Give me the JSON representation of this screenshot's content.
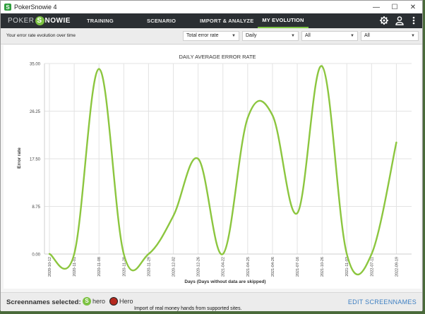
{
  "window": {
    "title": "PokerSnowie 4",
    "controls": [
      "—",
      "☐",
      "✕"
    ]
  },
  "logo": {
    "part1": "POKER",
    "s": "S",
    "part2": "NOWIE"
  },
  "nav": {
    "items": [
      {
        "label": "TRAINING",
        "active": false
      },
      {
        "label": "SCENARIO",
        "active": false
      },
      {
        "label": "IMPORT & ANALYZE",
        "active": false
      },
      {
        "label": "MY EVOLUTION",
        "active": true
      }
    ],
    "icons": [
      "gear-icon",
      "user-icon",
      "more-vertical-icon"
    ]
  },
  "filters": {
    "label": "Your error rate evolution over time",
    "metric": "Total error rate",
    "period": "Daily",
    "filter1": "All",
    "filter2": "All"
  },
  "chart_data": {
    "type": "line",
    "title": "DAILY AVERAGE ERROR RATE",
    "xlabel": "Days (Days without data are skipped)",
    "ylabel": "Error rate",
    "ylim": [
      0,
      35
    ],
    "yticks": [
      "0.00",
      "8.75",
      "17.50",
      "26.25",
      "35.00"
    ],
    "categories": [
      "2020-10-12",
      "2020-11-01",
      "2020-11-08",
      "2020-11-28",
      "2020-11-29",
      "2020-12-02",
      "2020-12-26",
      "2021-04-22",
      "2021-04-25",
      "2021-04-26",
      "2021-07-16",
      "2021-10-26",
      "2021-11-03",
      "2022-07-11",
      "2022-09-19"
    ],
    "series": [
      {
        "values": [
          0,
          0,
          34,
          0,
          0,
          7,
          17.5,
          0,
          25,
          25.5,
          7.5,
          34.5,
          0,
          0,
          20.5
        ]
      }
    ],
    "line_color": "#8cc63f",
    "grid": true
  },
  "bottom": {
    "label": "Screennames selected:",
    "screennames": [
      {
        "name": "hero",
        "color": "#7cc242",
        "icon": "snowie-icon"
      },
      {
        "name": "Hero",
        "color": "#b5281e",
        "icon": "poker-chip-icon"
      }
    ],
    "edit": "EDIT SCREENNAMES"
  },
  "background_text": "Import of real money hands from supported sites."
}
